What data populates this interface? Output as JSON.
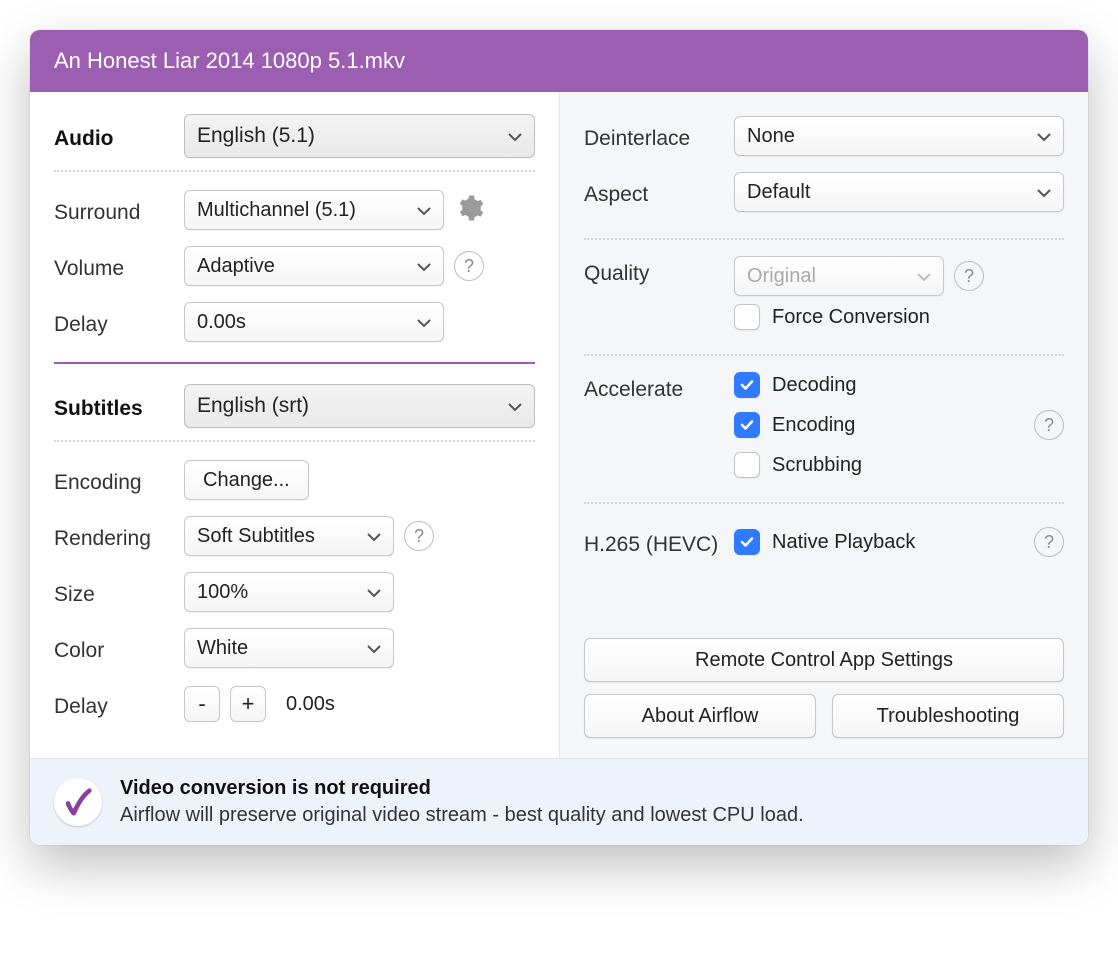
{
  "title": "An Honest Liar 2014 1080p 5.1.mkv",
  "left": {
    "audio": {
      "section": "Audio",
      "track": "English (5.1)",
      "surround_label": "Surround",
      "surround": "Multichannel (5.1)",
      "volume_label": "Volume",
      "volume": "Adaptive",
      "delay_label": "Delay",
      "delay": "0.00s"
    },
    "subtitles": {
      "section": "Subtitles",
      "track": "English (srt)",
      "encoding_label": "Encoding",
      "encoding_btn": "Change...",
      "rendering_label": "Rendering",
      "rendering": "Soft Subtitles",
      "size_label": "Size",
      "size": "100%",
      "color_label": "Color",
      "color": "White",
      "delay_label": "Delay",
      "delay_minus": "-",
      "delay_plus": "+",
      "delay_value": "0.00s"
    }
  },
  "right": {
    "deinterlace_label": "Deinterlace",
    "deinterlace": "None",
    "aspect_label": "Aspect",
    "aspect": "Default",
    "quality_label": "Quality",
    "quality": "Original",
    "force_conversion": "Force Conversion",
    "accelerate_label": "Accelerate",
    "decoding": "Decoding",
    "encoding": "Encoding",
    "scrubbing": "Scrubbing",
    "hevc_label": "H.265 (HEVC)",
    "native_playback": "Native Playback",
    "remote_btn": "Remote Control App Settings",
    "about_btn": "About Airflow",
    "trouble_btn": "Troubleshooting"
  },
  "footer": {
    "heading": "Video conversion is not required",
    "body": "Airflow will preserve original video stream - best quality and lowest CPU load."
  }
}
